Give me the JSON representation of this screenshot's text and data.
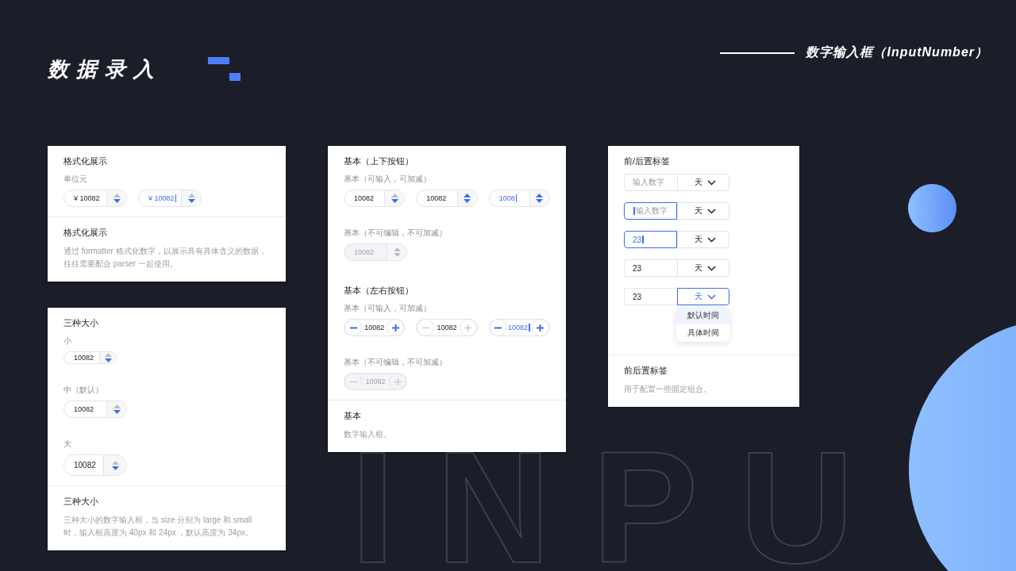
{
  "header": {
    "title": "数据录入",
    "subtitle": "数字输入框（InputNumber）"
  },
  "background_word": "INPU",
  "columns": [
    [
      {
        "body": [
          {
            "kind": "title",
            "text": "格式化展示"
          },
          {
            "kind": "label",
            "text": "单位元"
          },
          {
            "kind": "inputs",
            "inputs": [
              {
                "kind": "stepper",
                "value": "¥ 10082",
                "focused": false,
                "hovered": false,
                "disabled": false
              },
              {
                "kind": "stepper",
                "value": "¥ 10082",
                "focused": true,
                "hovered": false,
                "disabled": false
              }
            ]
          }
        ],
        "footer": {
          "title": "格式化展示",
          "description": "通过 formatter 格式化数字，以展示具有具体含义的数据，往往需要配合 parser 一起使用。"
        }
      },
      {
        "body": [
          {
            "kind": "title",
            "text": "三种大小"
          },
          {
            "kind": "label",
            "text": "小"
          },
          {
            "kind": "inputs",
            "inputs": [
              {
                "kind": "stepper",
                "value": "10082",
                "small": true,
                "focused": false,
                "hovered": false,
                "disabled": false
              }
            ]
          },
          {
            "kind": "label",
            "text": "中（默认）"
          },
          {
            "kind": "inputs",
            "inputs": [
              {
                "kind": "stepper",
                "value": "10082",
                "focused": false,
                "hovered": false,
                "disabled": false
              }
            ]
          },
          {
            "kind": "label",
            "text": "大"
          },
          {
            "kind": "inputs",
            "inputs": [
              {
                "kind": "stepper",
                "value": "10082",
                "large": true,
                "focused": false,
                "hovered": false,
                "disabled": false
              }
            ]
          }
        ],
        "footer": {
          "title": "三种大小",
          "description": "三种大小的数字输入框，当 size 分别为 large 和 small 时，输入框高度为 40px 和 24px ，默认高度为 34px。"
        }
      }
    ],
    [
      {
        "body": [
          {
            "kind": "title",
            "text": "基本（上下按钮）"
          },
          {
            "kind": "label",
            "text": "基本（可输入，可加减）"
          },
          {
            "kind": "inputs",
            "inputs": [
              {
                "kind": "stepper",
                "value": "10082",
                "focused": false,
                "hovered": false,
                "disabled": false
              },
              {
                "kind": "stepper",
                "value": "10082",
                "focused": false,
                "hovered": true,
                "disabled": false
              },
              {
                "kind": "stepper",
                "value": "1008",
                "focused": true,
                "hovered": true,
                "disabled": false
              }
            ]
          },
          {
            "kind": "label",
            "text": "基本（不可编辑，不可加减）"
          },
          {
            "kind": "inputs",
            "inputs": [
              {
                "kind": "stepper",
                "value": "10082",
                "focused": false,
                "disabled": true
              }
            ]
          },
          {
            "kind": "title",
            "text": "基本（左右按钮）"
          },
          {
            "kind": "label",
            "text": "基本（可输入，可加减）"
          },
          {
            "kind": "inputs",
            "inputs": [
              {
                "kind": "sided",
                "value": "10082",
                "focused": false,
                "buttons_disabled": false,
                "disabled": false
              },
              {
                "kind": "sided",
                "value": "10082",
                "focused": false,
                "buttons_disabled": true,
                "disabled": false
              },
              {
                "kind": "sided",
                "value": "10082",
                "focused": true,
                "buttons_disabled": false,
                "disabled": false
              }
            ]
          },
          {
            "kind": "label",
            "text": "基本（不可编辑，不可加减）"
          },
          {
            "kind": "inputs",
            "inputs": [
              {
                "kind": "sided",
                "value": "10082",
                "focused": false,
                "disabled": true
              }
            ]
          }
        ],
        "footer": {
          "title": "基本",
          "description": "数字输入框。"
        }
      }
    ],
    [
      {
        "body": [
          {
            "kind": "title",
            "text": "前/后置标签"
          },
          {
            "kind": "addons",
            "inputs": [
              {
                "kind": "addon",
                "placeholder": "输入数字",
                "suffix": "天",
                "focused": false,
                "dropdown_open": false
              },
              {
                "kind": "addon",
                "placeholder": "输入数字",
                "suffix": "天",
                "focused": true,
                "dropdown_open": false
              },
              {
                "kind": "addon",
                "value": "23",
                "suffix": "天",
                "focused": true,
                "dropdown_open": false
              },
              {
                "kind": "addon",
                "value": "23",
                "suffix": "天",
                "focused": false,
                "dropdown_open": false
              },
              {
                "kind": "addon",
                "value": "23",
                "suffix": "天",
                "focused": false,
                "dropdown_open": true,
                "options": [
                  {
                    "label": "默认时间",
                    "selected": true
                  },
                  {
                    "label": "具体时间",
                    "selected": false
                  }
                ]
              }
            ]
          }
        ],
        "footer": {
          "title": "前后置标签",
          "description": "用于配置一些固定组合。"
        }
      }
    ]
  ]
}
